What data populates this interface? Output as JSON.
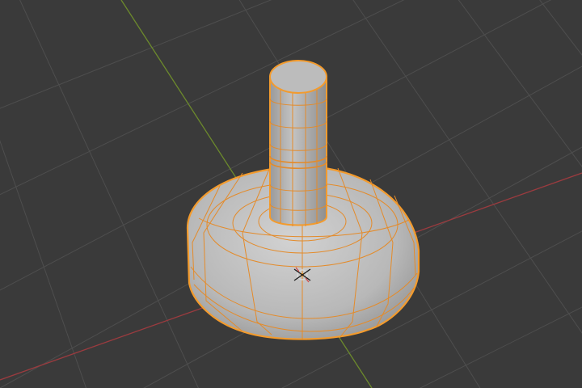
{
  "viewport": {
    "background_color": "#3a3a3a",
    "grid_color": "#4f4f4f",
    "x_axis_color": "#9b3b3f",
    "y_axis_color": "#6c8a2c",
    "selection_outline_color": "#f39b2d",
    "wire_color": "#e48b2a",
    "mesh_fill_color": "#b9b9b9",
    "mesh_shadow_color": "#8f8f8f",
    "origin_icon": "object-origin-icon",
    "selected_object": "mesh-object"
  }
}
